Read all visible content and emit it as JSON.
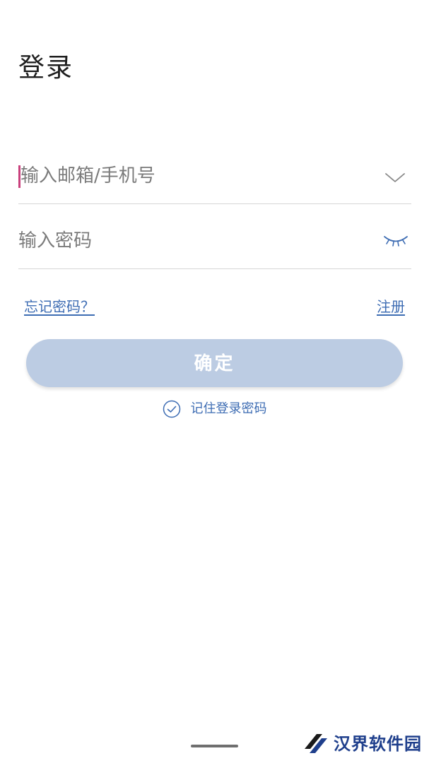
{
  "page": {
    "title": "登录"
  },
  "form": {
    "account_placeholder": "输入邮箱/手机号",
    "account_value": "",
    "password_placeholder": "输入密码",
    "password_value": ""
  },
  "links": {
    "forgot_password": "忘记密码？",
    "register": "注册"
  },
  "submit_label": "确定",
  "remember": {
    "label": "记住登录密码",
    "checked": true
  },
  "icons": {
    "account_dropdown": "chevron-down-icon",
    "password_toggle": "eye-closed-icon",
    "remember_check": "check-circle-icon"
  },
  "watermark": {
    "text": "汉界软件园"
  },
  "colors": {
    "accent": "#3d6cb3",
    "button_disabled": "#bccce3",
    "caret": "#c9407c",
    "divider": "#d6d6d6",
    "watermark": "#1f3f8c"
  }
}
